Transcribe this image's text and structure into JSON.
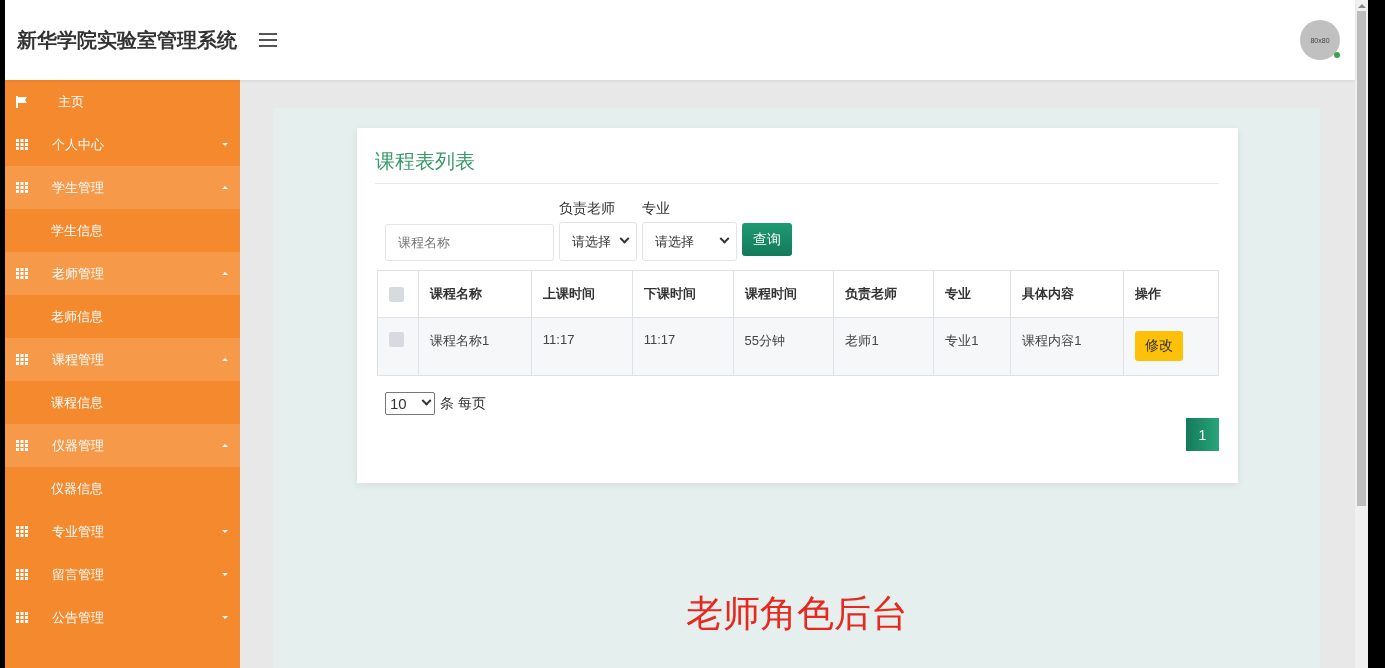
{
  "header": {
    "title": "新华学院实验室管理系统",
    "avatar_text": "80x80"
  },
  "sidebar": {
    "items": [
      {
        "kind": "link",
        "label": "主页"
      },
      {
        "kind": "group",
        "label": "个人中心",
        "expanded": false
      },
      {
        "kind": "group",
        "label": "学生管理",
        "expanded": true,
        "children": [
          {
            "label": "学生信息"
          }
        ]
      },
      {
        "kind": "group",
        "label": "老师管理",
        "expanded": true,
        "children": [
          {
            "label": "老师信息"
          }
        ]
      },
      {
        "kind": "group",
        "label": "课程管理",
        "expanded": true,
        "children": [
          {
            "label": "课程信息"
          }
        ]
      },
      {
        "kind": "group",
        "label": "仪器管理",
        "expanded": true,
        "children": [
          {
            "label": "仪器信息"
          }
        ]
      },
      {
        "kind": "group",
        "label": "专业管理",
        "expanded": false
      },
      {
        "kind": "group",
        "label": "留言管理",
        "expanded": false
      },
      {
        "kind": "group",
        "label": "公告管理",
        "expanded": false
      }
    ]
  },
  "card": {
    "title": "课程表列表",
    "filters": {
      "name_placeholder": "课程名称",
      "teacher_label": "负责老师",
      "teacher_value": "请选择",
      "major_label": "专业",
      "major_value": "请选择",
      "search_button": "查询"
    },
    "table": {
      "select_all_checked": false,
      "columns": [
        "课程名称",
        "上课时间",
        "下课时间",
        "课程时间",
        "负责老师",
        "专业",
        "具体内容",
        "操作"
      ],
      "rows": [
        {
          "checked": false,
          "cells": [
            "课程名称1",
            "11:17",
            "11:17",
            "55分钟",
            "老师1",
            "专业1",
            "课程内容1"
          ],
          "action": "修改"
        }
      ]
    },
    "page_size": "10",
    "page_size_label": "条 每页",
    "pages": [
      {
        "label": "1",
        "selected": true
      }
    ]
  },
  "caption": "老师角色后台"
}
